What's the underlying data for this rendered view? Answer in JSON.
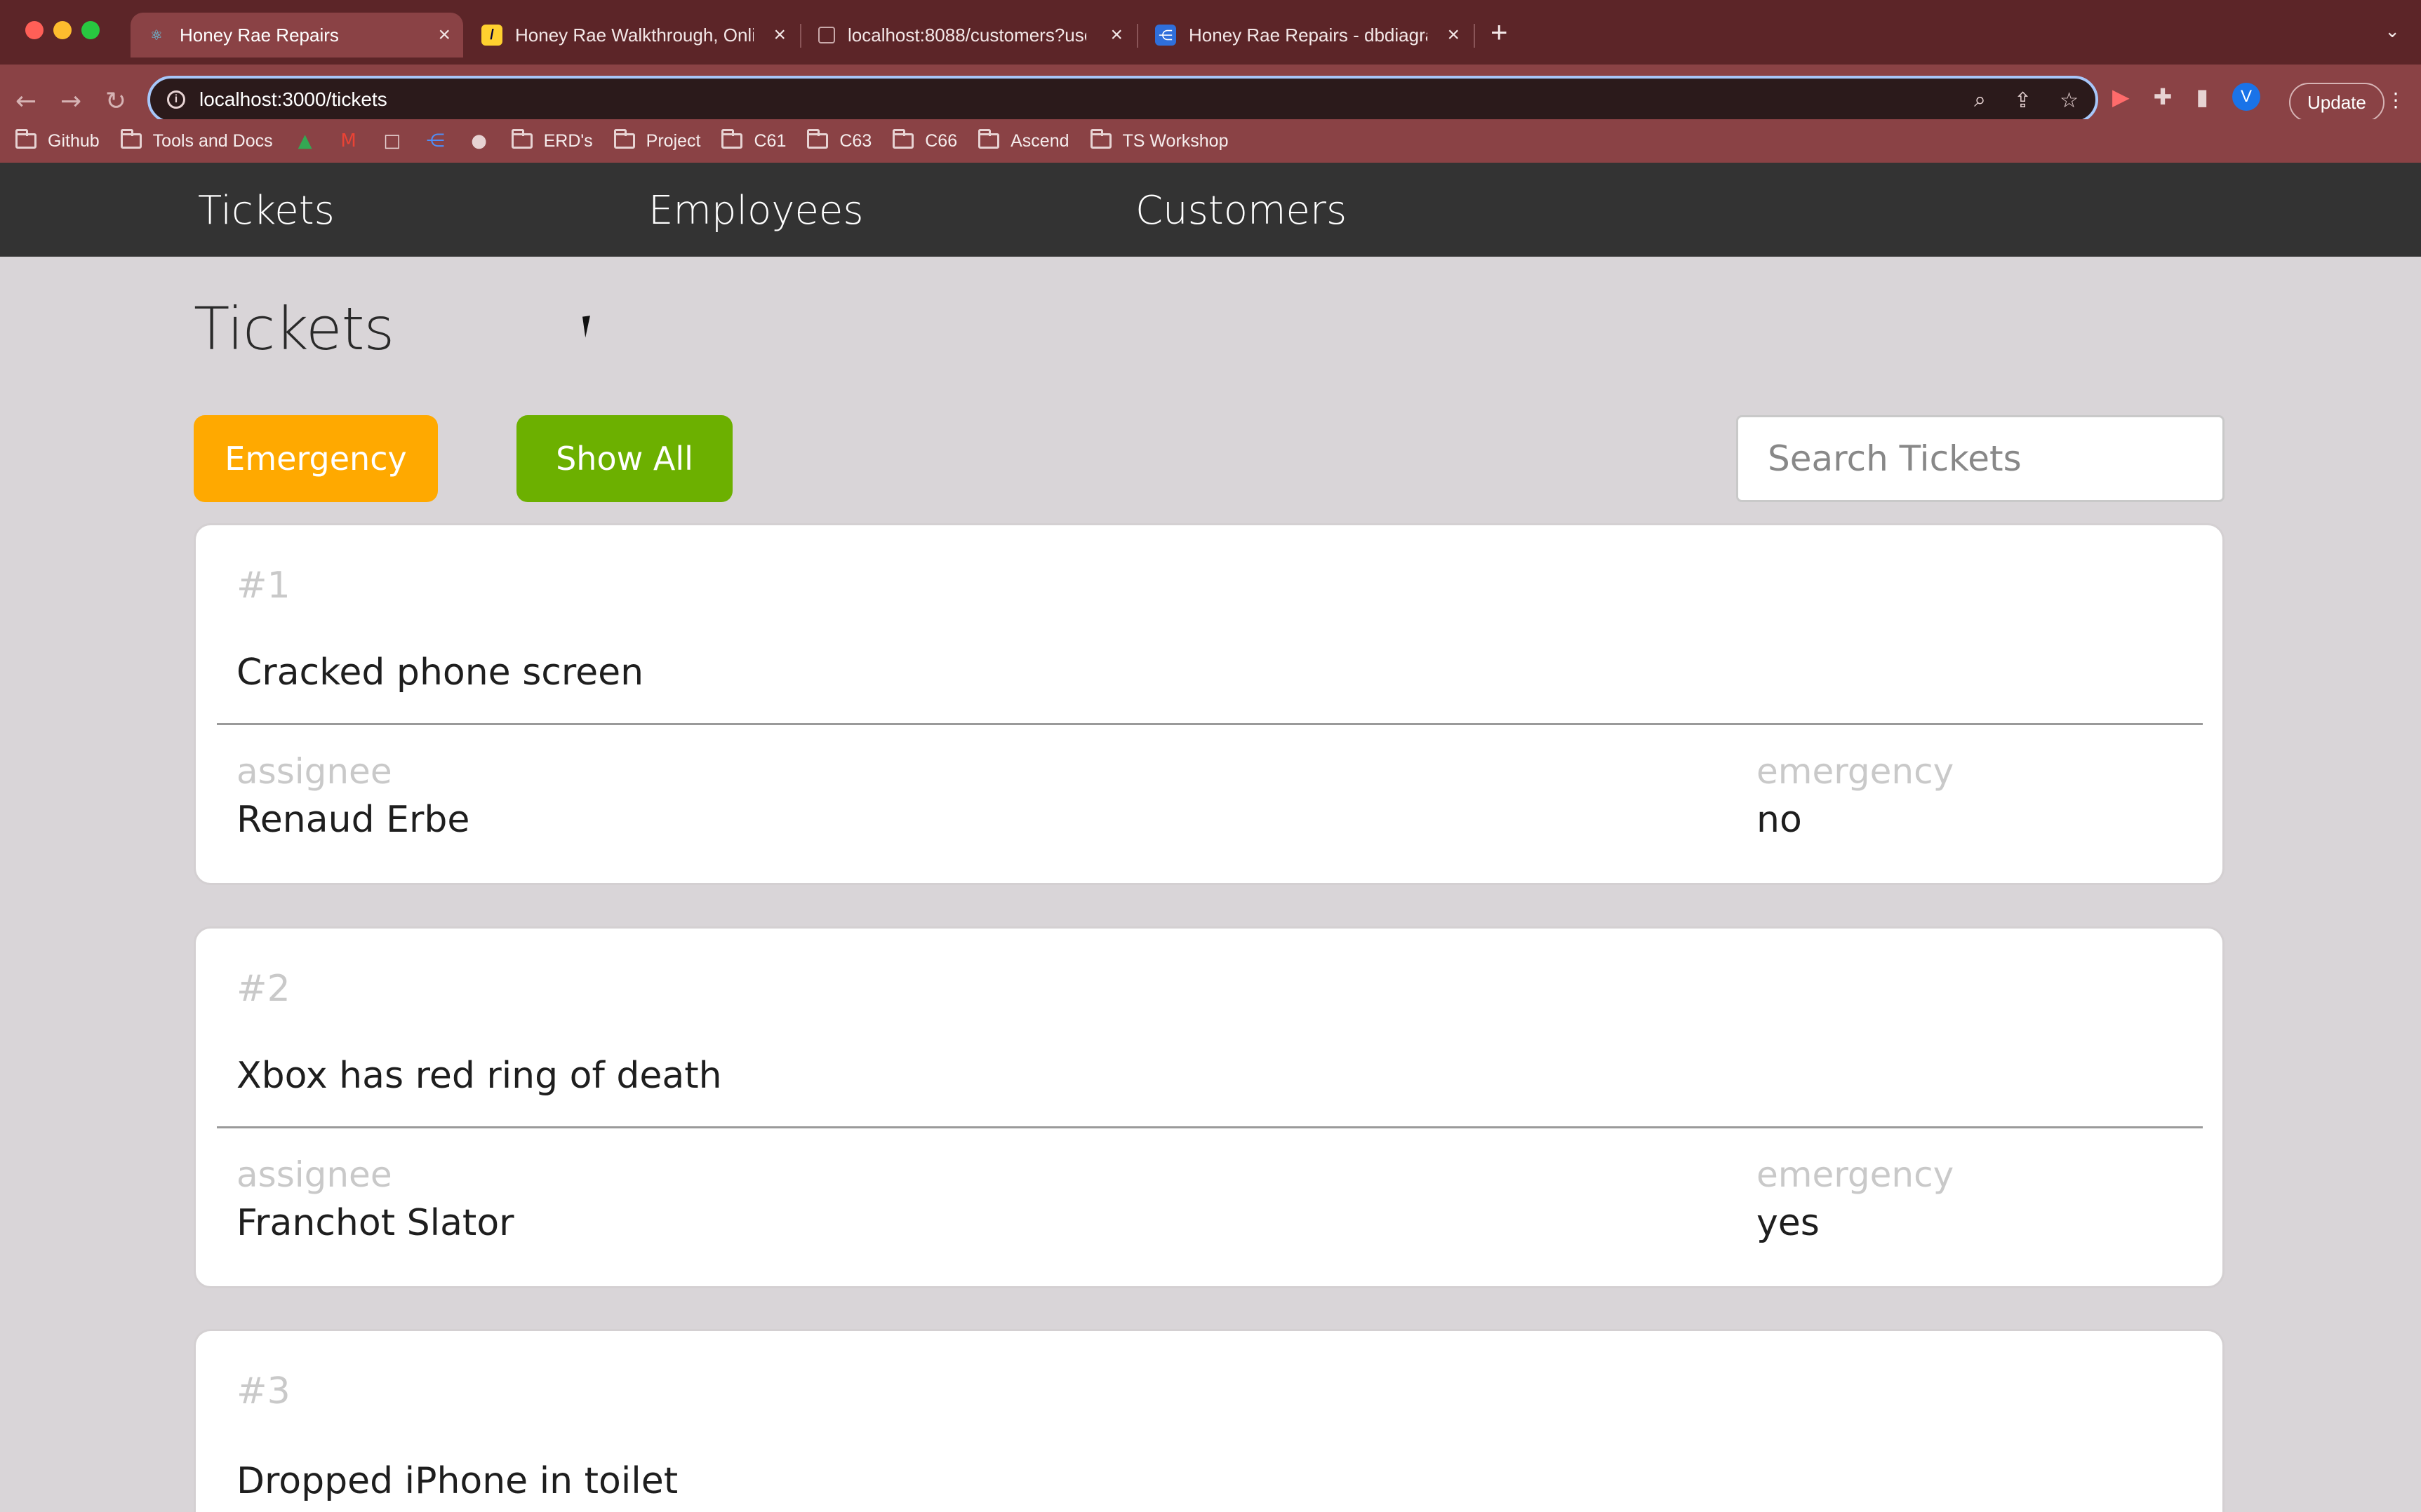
{
  "browser": {
    "tabs": [
      {
        "title": "Honey Rae Repairs",
        "active": true,
        "icon": "react-icon"
      },
      {
        "title": "Honey Rae Walkthrough, Onlin",
        "active": false,
        "icon": "miro-icon"
      },
      {
        "title": "localhost:8088/customers?use",
        "active": false,
        "icon": "page-icon"
      },
      {
        "title": "Honey Rae Repairs - dbdiagran",
        "active": false,
        "icon": "dbdiagram-icon"
      }
    ],
    "url": "localhost:3000/tickets",
    "profile_initial": "V",
    "update_label": "Update",
    "bookmarks": [
      {
        "label": "Github",
        "type": "folder"
      },
      {
        "label": "Tools and Docs",
        "type": "folder"
      },
      {
        "label": "",
        "type": "google-drive-icon"
      },
      {
        "label": "",
        "type": "gmail-icon"
      },
      {
        "label": "",
        "type": "square-icon"
      },
      {
        "label": "",
        "type": "share-icon"
      },
      {
        "label": "",
        "type": "github-icon"
      },
      {
        "label": "ERD's",
        "type": "folder"
      },
      {
        "label": "Project",
        "type": "folder"
      },
      {
        "label": "C61",
        "type": "folder"
      },
      {
        "label": "C63",
        "type": "folder"
      },
      {
        "label": "C66",
        "type": "folder"
      },
      {
        "label": "Ascend",
        "type": "folder"
      },
      {
        "label": "TS Workshop",
        "type": "folder"
      }
    ]
  },
  "nav": {
    "tickets": "Tickets",
    "employees": "Employees",
    "customers": "Customers"
  },
  "page": {
    "title": "Tickets",
    "emergency_button": "Emergency",
    "show_all_button": "Show All",
    "search_placeholder": "Search Tickets"
  },
  "ticket_labels": {
    "assignee": "assignee",
    "emergency": "emergency"
  },
  "tickets": [
    {
      "number": "#1",
      "description": "Cracked phone screen",
      "assignee": "Renaud Erbe",
      "emergency": "no"
    },
    {
      "number": "#2",
      "description": "Xbox has red ring of death",
      "assignee": "Franchot Slator",
      "emergency": "yes"
    },
    {
      "number": "#3",
      "description": "Dropped iPhone in toilet",
      "assignee": "",
      "emergency": ""
    }
  ],
  "colors": {
    "emergency_button": "#ffa900",
    "show_all_button": "#6cb000",
    "nav_background": "#333333",
    "page_background": "#d9d5d8",
    "browser_frame": "#8a4245"
  }
}
